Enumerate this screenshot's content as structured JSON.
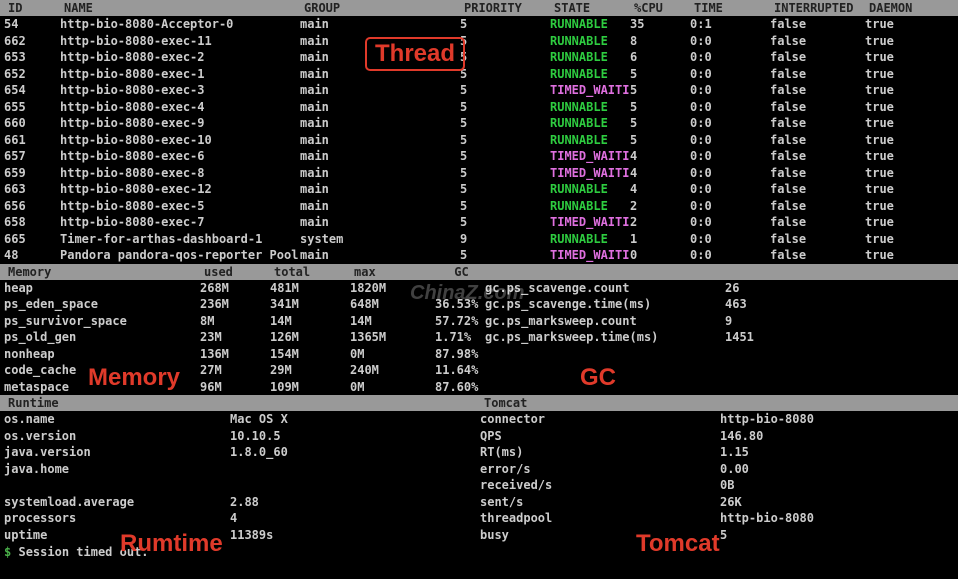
{
  "thread_header": {
    "id": "ID",
    "name": "NAME",
    "group": "GROUP",
    "priority": "PRIORITY",
    "state": "STATE",
    "cpu": "%CPU",
    "time": "TIME",
    "interrupted": "INTERRUPTED",
    "daemon": "DAEMON"
  },
  "threads": [
    {
      "id": "54",
      "name": "http-bio-8080-Acceptor-0",
      "group": "main",
      "priority": "5",
      "state": "RUNNABLE",
      "cpu": "35",
      "time": "0:1",
      "interrupted": "false",
      "daemon": "true"
    },
    {
      "id": "662",
      "name": "http-bio-8080-exec-11",
      "group": "main",
      "priority": "5",
      "state": "RUNNABLE",
      "cpu": "8",
      "time": "0:0",
      "interrupted": "false",
      "daemon": "true"
    },
    {
      "id": "653",
      "name": "http-bio-8080-exec-2",
      "group": "main",
      "priority": "5",
      "state": "RUNNABLE",
      "cpu": "6",
      "time": "0:0",
      "interrupted": "false",
      "daemon": "true"
    },
    {
      "id": "652",
      "name": "http-bio-8080-exec-1",
      "group": "main",
      "priority": "5",
      "state": "RUNNABLE",
      "cpu": "5",
      "time": "0:0",
      "interrupted": "false",
      "daemon": "true"
    },
    {
      "id": "654",
      "name": "http-bio-8080-exec-3",
      "group": "main",
      "priority": "5",
      "state": "TIMED_WAITI",
      "cpu": "5",
      "time": "0:0",
      "interrupted": "false",
      "daemon": "true"
    },
    {
      "id": "655",
      "name": "http-bio-8080-exec-4",
      "group": "main",
      "priority": "5",
      "state": "RUNNABLE",
      "cpu": "5",
      "time": "0:0",
      "interrupted": "false",
      "daemon": "true"
    },
    {
      "id": "660",
      "name": "http-bio-8080-exec-9",
      "group": "main",
      "priority": "5",
      "state": "RUNNABLE",
      "cpu": "5",
      "time": "0:0",
      "interrupted": "false",
      "daemon": "true"
    },
    {
      "id": "661",
      "name": "http-bio-8080-exec-10",
      "group": "main",
      "priority": "5",
      "state": "RUNNABLE",
      "cpu": "5",
      "time": "0:0",
      "interrupted": "false",
      "daemon": "true"
    },
    {
      "id": "657",
      "name": "http-bio-8080-exec-6",
      "group": "main",
      "priority": "5",
      "state": "TIMED_WAITI",
      "cpu": "4",
      "time": "0:0",
      "interrupted": "false",
      "daemon": "true"
    },
    {
      "id": "659",
      "name": "http-bio-8080-exec-8",
      "group": "main",
      "priority": "5",
      "state": "TIMED_WAITI",
      "cpu": "4",
      "time": "0:0",
      "interrupted": "false",
      "daemon": "true"
    },
    {
      "id": "663",
      "name": "http-bio-8080-exec-12",
      "group": "main",
      "priority": "5",
      "state": "RUNNABLE",
      "cpu": "4",
      "time": "0:0",
      "interrupted": "false",
      "daemon": "true"
    },
    {
      "id": "656",
      "name": "http-bio-8080-exec-5",
      "group": "main",
      "priority": "5",
      "state": "RUNNABLE",
      "cpu": "2",
      "time": "0:0",
      "interrupted": "false",
      "daemon": "true"
    },
    {
      "id": "658",
      "name": "http-bio-8080-exec-7",
      "group": "main",
      "priority": "5",
      "state": "TIMED_WAITI",
      "cpu": "2",
      "time": "0:0",
      "interrupted": "false",
      "daemon": "true"
    },
    {
      "id": "665",
      "name": "Timer-for-arthas-dashboard-1",
      "group": "system",
      "priority": "9",
      "state": "RUNNABLE",
      "cpu": "1",
      "time": "0:0",
      "interrupted": "false",
      "daemon": "true"
    },
    {
      "id": "48",
      "name": "Pandora pandora-qos-reporter Pool",
      "group": "main",
      "priority": "5",
      "state": "TIMED_WAITI",
      "cpu": "0",
      "time": "0:0",
      "interrupted": "false",
      "daemon": "true"
    }
  ],
  "memory_header": {
    "title": "Memory",
    "used": "used",
    "total": "total",
    "max": "max",
    "gc": "GC"
  },
  "memory": [
    {
      "name": "heap",
      "used": "268M",
      "total": "481M",
      "max": "1820M",
      "pct": ""
    },
    {
      "name": "ps_eden_space",
      "used": "236M",
      "total": "341M",
      "max": "648M",
      "pct": "36.53%"
    },
    {
      "name": "ps_survivor_space",
      "used": "8M",
      "total": "14M",
      "max": "14M",
      "pct": "57.72%"
    },
    {
      "name": "ps_old_gen",
      "used": "23M",
      "total": "126M",
      "max": "1365M",
      "pct": "1.71%"
    },
    {
      "name": "nonheap",
      "used": "136M",
      "total": "154M",
      "max": "0M",
      "pct": "87.98%"
    },
    {
      "name": "code_cache",
      "used": "27M",
      "total": "29M",
      "max": "240M",
      "pct": "11.64%"
    },
    {
      "name": "metaspace",
      "used": "96M",
      "total": "109M",
      "max": "0M",
      "pct": "87.60%"
    }
  ],
  "gc": [
    {
      "key": "gc.ps_scavenge.count",
      "val": "26"
    },
    {
      "key": "gc.ps_scavenge.time(ms)",
      "val": "463"
    },
    {
      "key": "gc.ps_marksweep.count",
      "val": "9"
    },
    {
      "key": "gc.ps_marksweep.time(ms)",
      "val": "1451"
    }
  ],
  "runtime_header": {
    "runtime": "Runtime",
    "tomcat": "Tomcat"
  },
  "runtime": [
    {
      "name": "os.name",
      "val": "Mac OS X",
      "tc_name": "connector",
      "tc_val": "http-bio-8080"
    },
    {
      "name": "os.version",
      "val": "10.10.5",
      "tc_name": "QPS",
      "tc_val": "146.80"
    },
    {
      "name": "java.version",
      "val": "1.8.0_60",
      "tc_name": "RT(ms)",
      "tc_val": "1.15"
    },
    {
      "name": "java.home",
      "val": "",
      "tc_name": "error/s",
      "tc_val": "0.00"
    },
    {
      "name": "",
      "val": "",
      "tc_name": "received/s",
      "tc_val": "0B"
    },
    {
      "name": "systemload.average",
      "val": "2.88",
      "tc_name": "sent/s",
      "tc_val": "26K"
    },
    {
      "name": "processors",
      "val": "4",
      "tc_name": "threadpool",
      "tc_val": "http-bio-8080"
    },
    {
      "name": "uptime",
      "val": "11389s",
      "tc_name": "busy",
      "tc_val": "5"
    }
  ],
  "prompt": {
    "symbol": "$",
    "text": "Session timed out."
  },
  "overlays": {
    "thread": "Thread",
    "memory": "Memory",
    "gc": "GC",
    "runtime": "Rumtime",
    "tomcat": "Tomcat"
  },
  "watermark": {
    "main": "ChinaZ.com",
    "sub": ""
  }
}
